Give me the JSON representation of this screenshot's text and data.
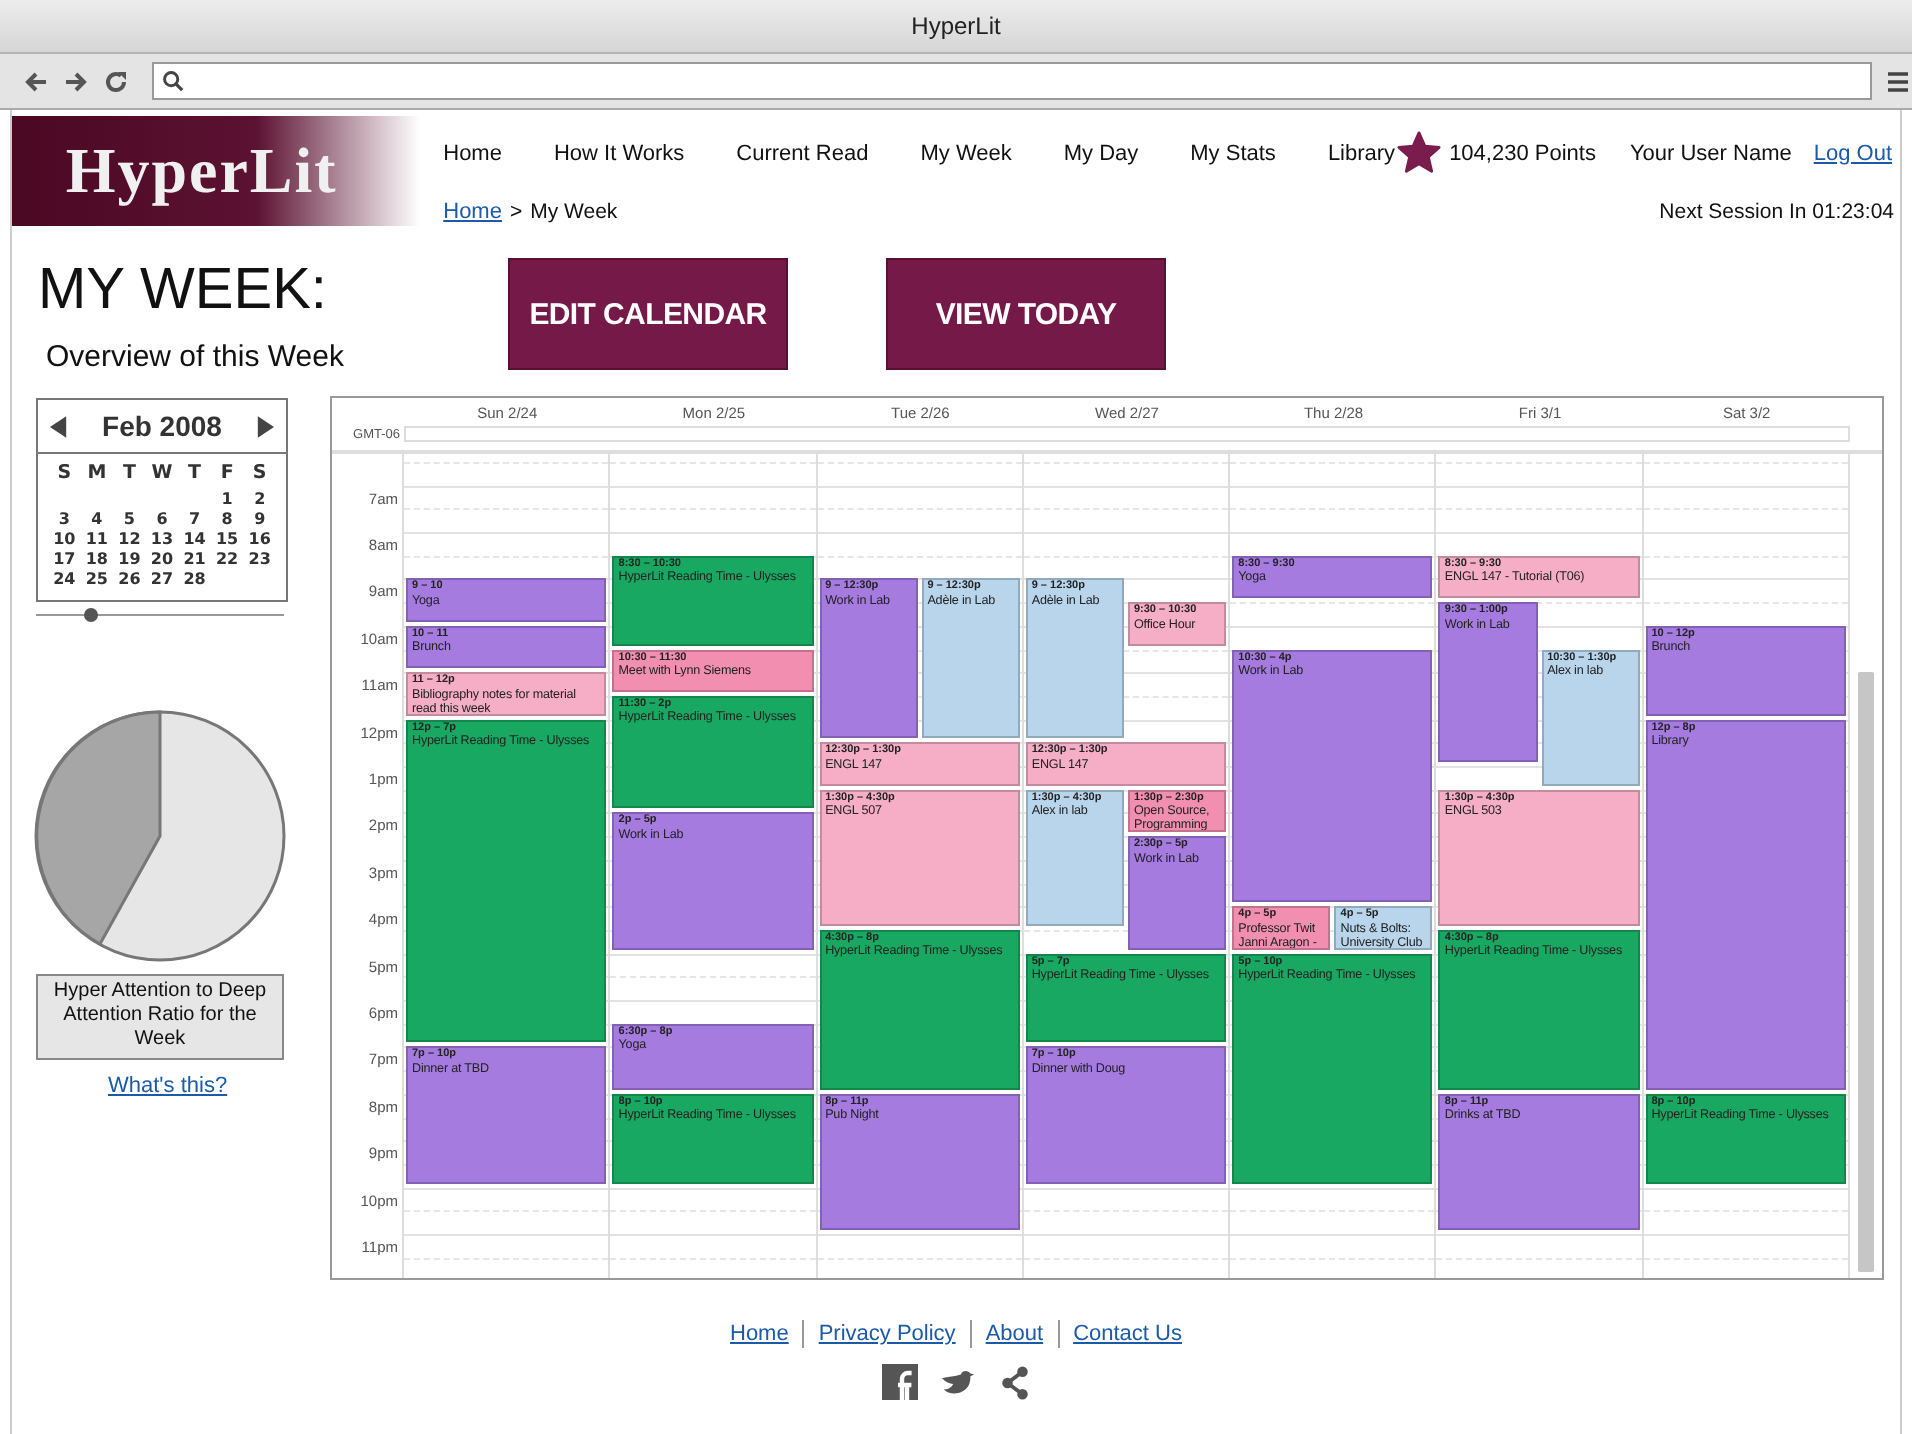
{
  "window": {
    "title": "HyperLit"
  },
  "logo": "HyperLit",
  "nav": [
    "Home",
    "How It Works",
    "Current Read",
    "My Week",
    "My Day",
    "My Stats",
    "Library"
  ],
  "account": {
    "points": "104,230 Points",
    "user": "Your User Name",
    "logout": "Log Out"
  },
  "breadcrumb": {
    "link": "Home",
    "separator": ">",
    "current": "My Week"
  },
  "next_session": "Next Session In 01:23:04",
  "heading": "MY WEEK:",
  "subheading": "Overview of this Week",
  "buttons": [
    "EDIT CALENDAR",
    "VIEW TODAY"
  ],
  "mini_calendar": {
    "month": "Feb 2008",
    "weekdays": [
      "S",
      "M",
      "T",
      "W",
      "T",
      "F",
      "S"
    ],
    "weeks": [
      [
        "1",
        "2"
      ],
      [
        "3",
        "4",
        "5",
        "6",
        "7",
        "8",
        "9"
      ],
      [
        "10",
        "11",
        "12",
        "13",
        "14",
        "15",
        "16"
      ],
      [
        "17",
        "18",
        "19",
        "20",
        "21",
        "22",
        "23"
      ],
      [
        "24",
        "25",
        "26",
        "27",
        "28"
      ]
    ],
    "slider": {
      "level": 0.22
    }
  },
  "ratio": {
    "label": "Hyper Attention to Deep Attention Ratio for the Week",
    "link": "What's this?"
  },
  "calendar": {
    "timezone": "GMT-06",
    "hours": [
      "7am",
      "8am",
      "9am",
      "10am",
      "11am",
      "12pm",
      "1pm",
      "2pm",
      "3pm",
      "4pm",
      "5pm",
      "6pm",
      "7pm",
      "8pm",
      "9pm",
      "10pm",
      "11pm"
    ],
    "days": [
      {
        "label": "Sun 2/24",
        "events": [
          {
            "time": "9 – 10",
            "title": "Yoga",
            "color": "#a57be0"
          },
          {
            "time": "10 – 11",
            "title": "Brunch",
            "color": "#a57be0"
          },
          {
            "time": "11 – 12p",
            "title": "Bibliography notes for material read this week",
            "color": "#f5aec6"
          },
          {
            "time": "12p – 7p",
            "title": "HyperLit Reading Time - Ulysses",
            "color": "#18a862"
          },
          {
            "time": "7p – 10p",
            "title": "Dinner at TBD",
            "color": "#a57be0"
          }
        ]
      },
      {
        "label": "Mon 2/25",
        "events": [
          {
            "time": "8:30 – 10:30",
            "title": "HyperLit Reading Time - Ulysses",
            "color": "#18a862"
          },
          {
            "time": "10:30 – 11:30",
            "title": "Meet with Lynn Siemens",
            "color": "#f28fb0"
          },
          {
            "time": "11:30 – 2p",
            "title": "HyperLit Reading Time - Ulysses",
            "color": "#18a862"
          },
          {
            "time": "2p – 5p",
            "title": "Work in Lab",
            "color": "#a57be0"
          },
          {
            "time": "6:30p – 8p",
            "title": "Yoga",
            "color": "#a57be0"
          },
          {
            "time": "8p – 10p",
            "title": "HyperLit Reading Time - Ulysses",
            "color": "#18a862"
          }
        ]
      },
      {
        "label": "Tue 2/26",
        "events": [
          {
            "time": "9 – 12:30p",
            "title": "Work in Lab",
            "color": "#a57be0"
          },
          {
            "time": "9 – 12:30p",
            "title": "Adèle in Lab",
            "color": "#b8d5ec"
          },
          {
            "time": "12:30p – 1:30p",
            "title": "ENGL 147",
            "color": "#f5aec6"
          },
          {
            "time": "1:30p – 4:30p",
            "title": "ENGL 507",
            "color": "#f5aec6"
          },
          {
            "time": "4:30p – 8p",
            "title": "HyperLit Reading Time - Ulysses",
            "color": "#18a862"
          },
          {
            "time": "8p – 11p",
            "title": "Pub Night",
            "color": "#a57be0"
          }
        ]
      },
      {
        "label": "Wed 2/27",
        "events": [
          {
            "time": "9 – 12:30p",
            "title": "Adèle in Lab",
            "color": "#b8d5ec"
          },
          {
            "time": "9:30 – 10:30",
            "title": "Office Hour",
            "color": "#f5aec6"
          },
          {
            "time": "12:30p – 1:30p",
            "title": "ENGL 147",
            "color": "#f5aec6"
          },
          {
            "time": "1:30p – 4:30p",
            "title": "Alex in lab",
            "color": "#b8d5ec"
          },
          {
            "time": "1:30p – 2:30p",
            "title": "Open Source, Programming",
            "color": "#f28fb0"
          },
          {
            "time": "2:30p – 5p",
            "title": "Work in Lab",
            "color": "#a57be0"
          },
          {
            "time": "5p – 7p",
            "title": "HyperLit Reading Time - Ulysses",
            "color": "#18a862"
          },
          {
            "time": "7p – 10p",
            "title": "Dinner with Doug",
            "color": "#a57be0"
          }
        ]
      },
      {
        "label": "Thu 2/28",
        "events": [
          {
            "time": "8:30 – 9:30",
            "title": "Yoga",
            "color": "#a57be0"
          },
          {
            "time": "10:30 – 4p",
            "title": "Work in Lab",
            "color": "#a57be0"
          },
          {
            "time": "4p – 5p",
            "title": "Professor Twit Janni Aragon -",
            "color": "#f28fb0"
          },
          {
            "time": "4p – 5p",
            "title": "Nuts & Bolts: University Club",
            "color": "#b8d5ec"
          },
          {
            "time": "5p – 10p",
            "title": "HyperLit Reading Time - Ulysses",
            "color": "#18a862"
          }
        ]
      },
      {
        "label": "Fri 3/1",
        "events": [
          {
            "time": "8:30 – 9:30",
            "title": "ENGL 147 - Tutorial (T06)",
            "color": "#f5aec6"
          },
          {
            "time": "9:30 – 1:00p",
            "title": "Work in Lab",
            "color": "#a57be0"
          },
          {
            "time": "10:30 – 1:30p",
            "title": "Alex in lab",
            "color": "#b8d5ec"
          },
          {
            "time": "1:30p – 4:30p",
            "title": "ENGL 503",
            "color": "#f5aec6"
          },
          {
            "time": "4:30p – 8p",
            "title": "HyperLit Reading Time - Ulysses",
            "color": "#18a862"
          },
          {
            "time": "8p – 11p",
            "title": "Drinks at TBD",
            "color": "#a57be0"
          }
        ]
      },
      {
        "label": "Sat 3/2",
        "events": [
          {
            "time": "10 – 12p",
            "title": "Brunch",
            "color": "#a57be0"
          },
          {
            "time": "12p – 8p",
            "title": "Library",
            "color": "#a57be0"
          },
          {
            "time": "8p – 10p",
            "title": "HyperLit Reading Time - Ulysses",
            "color": "#18a862"
          }
        ]
      }
    ]
  },
  "footer": {
    "links": [
      "Home",
      "Privacy Policy",
      "About",
      "Contact Us"
    ]
  }
}
